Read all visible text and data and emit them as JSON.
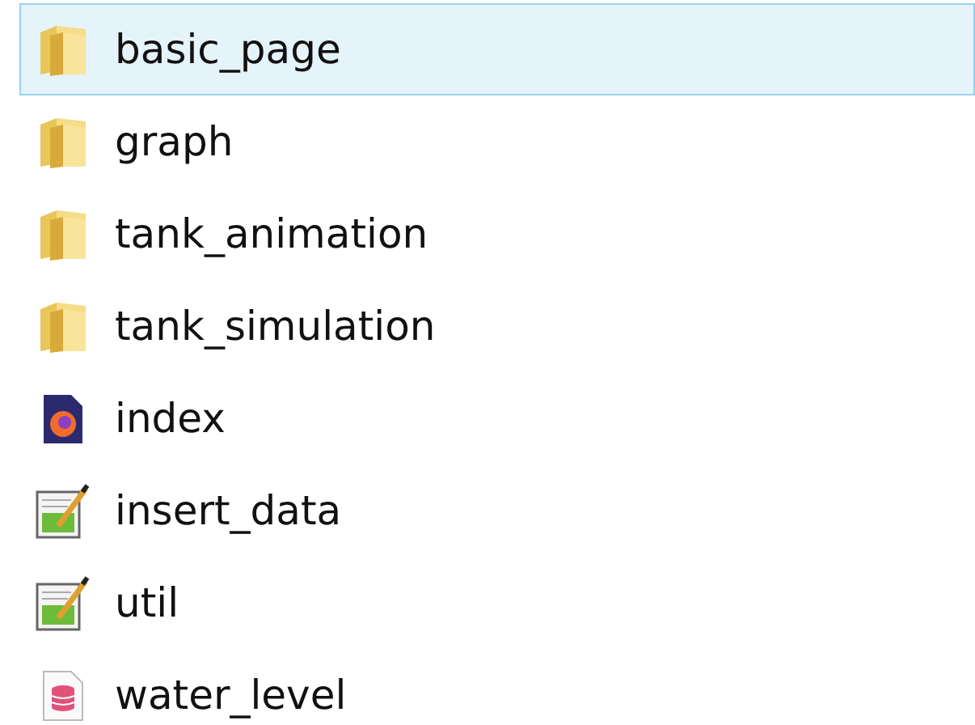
{
  "files": [
    {
      "name": "basic_page",
      "kind": "folder",
      "selected": true
    },
    {
      "name": "graph",
      "kind": "folder",
      "selected": false
    },
    {
      "name": "tank_animation",
      "kind": "folder",
      "selected": false
    },
    {
      "name": "tank_simulation",
      "kind": "folder",
      "selected": false
    },
    {
      "name": "index",
      "kind": "html",
      "selected": false
    },
    {
      "name": "insert_data",
      "kind": "script",
      "selected": false
    },
    {
      "name": "util",
      "kind": "script",
      "selected": false
    },
    {
      "name": "water_level",
      "kind": "database",
      "selected": false
    }
  ]
}
